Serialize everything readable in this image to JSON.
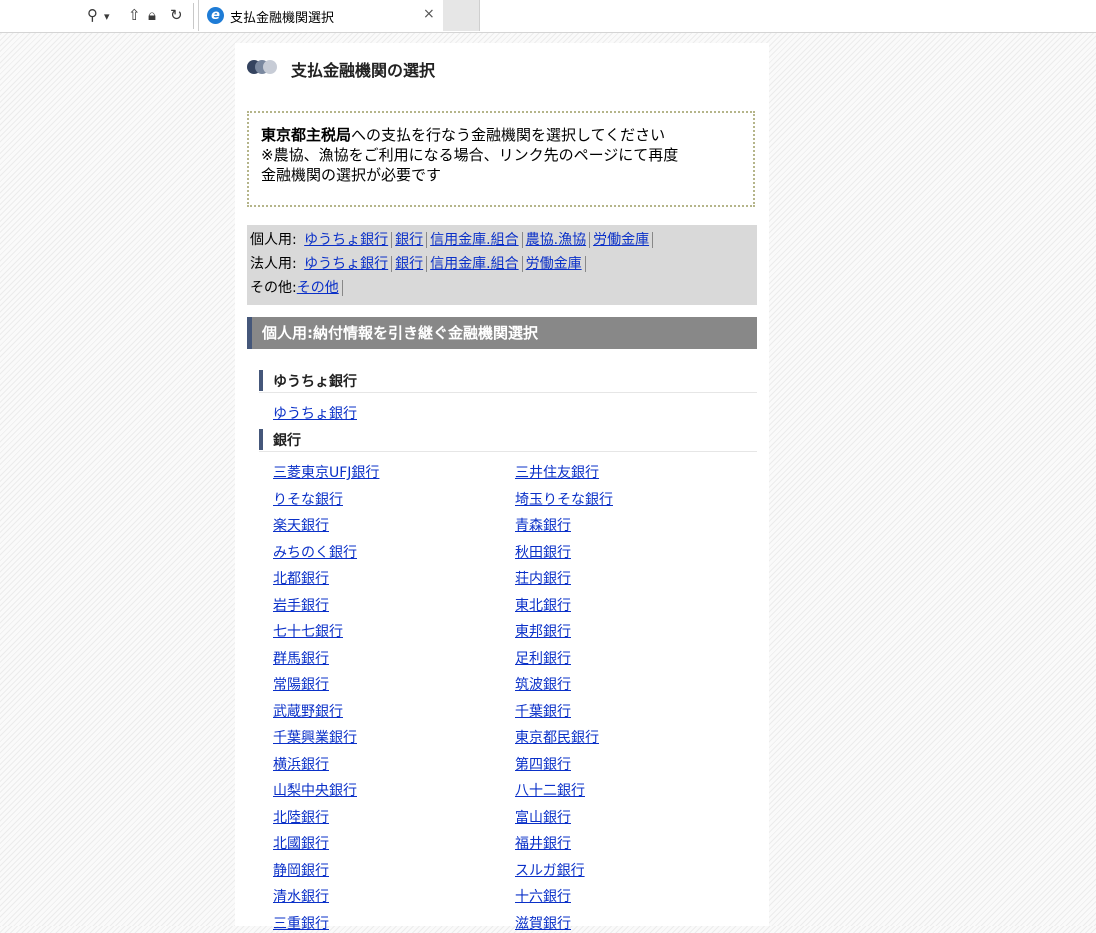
{
  "browser": {
    "toolbar_icons": [
      "search-icon",
      "dropdown-arrow-icon",
      "share-icon",
      "lock-icon",
      "refresh-icon"
    ],
    "tab_title": "支払金融機関選択",
    "tab_close": "×"
  },
  "page": {
    "title": "支払金融機関の選択",
    "notice": {
      "bold": "東京都主税局",
      "text1": "への支払を行なう金融機関を選択してください",
      "text2": "※農協、漁協をご利用になる場合、リンク先のページにて再度",
      "text3": "金融機関の選択が必要です"
    },
    "nav": {
      "personal_label": "個人用:",
      "personal_links": [
        "ゆうちょ銀行",
        "銀行",
        "信用金庫.組合",
        "農協.漁協",
        "労働金庫"
      ],
      "corporate_label": "法人用:",
      "corporate_links": [
        "ゆうちょ銀行",
        "銀行",
        "信用金庫.組合",
        "労働金庫"
      ],
      "other_label": "その他:",
      "other_links": [
        "その他"
      ]
    },
    "section_title": "個人用:納付情報を引き継ぐ金融機関選択",
    "yucho_heading": "ゆうちょ銀行",
    "yucho_link": "ゆうちょ銀行",
    "bank_heading": "銀行",
    "banks": [
      [
        "三菱東京UFJ銀行",
        "三井住友銀行"
      ],
      [
        "りそな銀行",
        "埼玉りそな銀行"
      ],
      [
        "楽天銀行",
        "青森銀行"
      ],
      [
        "みちのく銀行",
        "秋田銀行"
      ],
      [
        "北都銀行",
        "荘内銀行"
      ],
      [
        "岩手銀行",
        "東北銀行"
      ],
      [
        "七十七銀行",
        "東邦銀行"
      ],
      [
        "群馬銀行",
        "足利銀行"
      ],
      [
        "常陽銀行",
        "筑波銀行"
      ],
      [
        "武蔵野銀行",
        "千葉銀行"
      ],
      [
        "千葉興業銀行",
        "東京都民銀行"
      ],
      [
        "横浜銀行",
        "第四銀行"
      ],
      [
        "山梨中央銀行",
        "八十二銀行"
      ],
      [
        "北陸銀行",
        "富山銀行"
      ],
      [
        "北國銀行",
        "福井銀行"
      ],
      [
        "静岡銀行",
        "スルガ銀行"
      ],
      [
        "清水銀行",
        "十六銀行"
      ],
      [
        "三重銀行",
        "滋賀銀行"
      ]
    ]
  }
}
